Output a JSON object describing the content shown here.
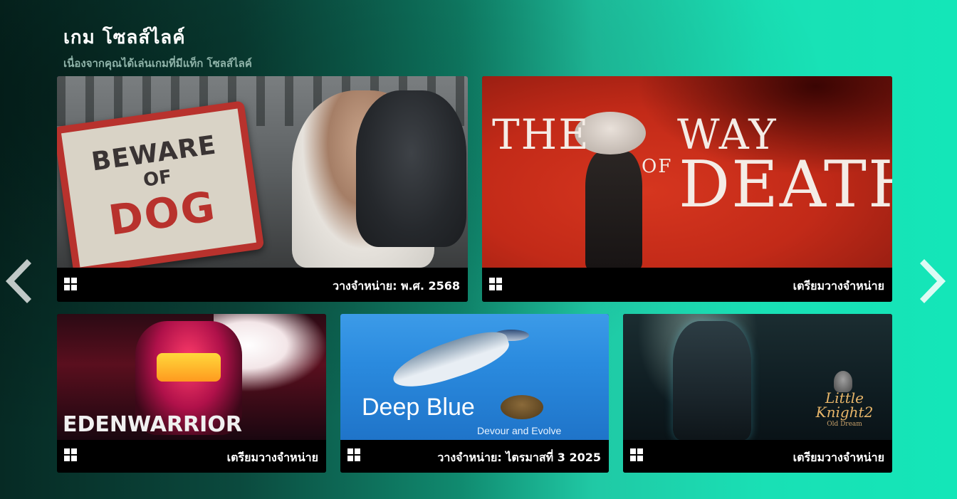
{
  "section": {
    "title": "เกม โซลส์ไลค์",
    "subtitle": "เนื่องจากคุณได้เล่นเกมที่มีแท็ก โซลส์ไลค์"
  },
  "games": [
    {
      "art_text": {
        "line1": "BEWARE",
        "line2": "OF",
        "line3": "DOG"
      },
      "platform_icon": "windows-icon",
      "release": "วางจำหน่าย: พ.ศ. 2568"
    },
    {
      "art_text": {
        "line1": "THE",
        "line2": "WAY",
        "line3": "OF",
        "line4": "DEATH"
      },
      "platform_icon": "windows-icon",
      "release": "เตรียมวางจำหน่าย"
    },
    {
      "art_text": {
        "line1": "EDENWARRIOR"
      },
      "platform_icon": "windows-icon",
      "release": "เตรียมวางจำหน่าย"
    },
    {
      "art_text": {
        "line1": "Deep Blue",
        "line2": "Devour and Evolve"
      },
      "platform_icon": "windows-icon",
      "release": "วางจำหน่าย: ไตรมาสที่ 3 2025"
    },
    {
      "art_text": {
        "line1": "Little",
        "line2": "Knight2",
        "line3": "Old Dream"
      },
      "platform_icon": "windows-icon",
      "release": "เตรียมวางจำหน่าย"
    }
  ],
  "navigation": {
    "prev_icon": "chevron-left-icon",
    "next_icon": "chevron-right-icon"
  },
  "colors": {
    "background_start": "#062a24",
    "background_end": "#14e6b8",
    "card_footer": "#000000",
    "subtitle": "#8fb3a9"
  }
}
